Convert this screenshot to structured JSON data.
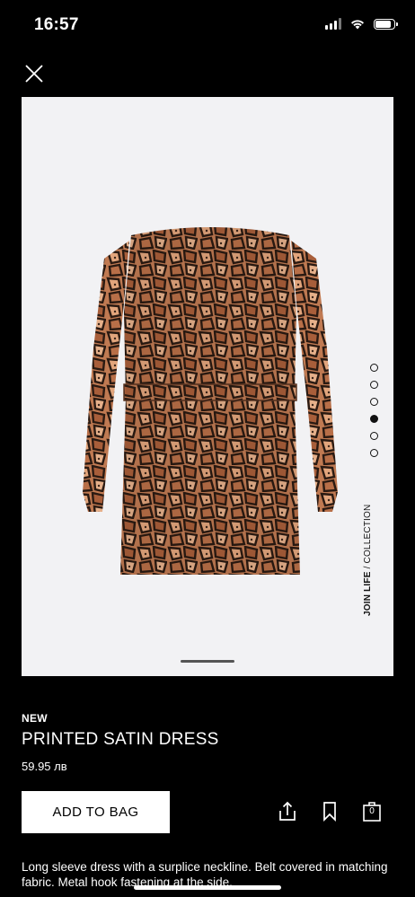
{
  "status_bar": {
    "time": "16:57",
    "icons": [
      "cellular-signal-icon",
      "wifi-icon",
      "battery-icon"
    ],
    "battery_level": 0.85
  },
  "close_icon": "close-icon",
  "gallery": {
    "image": "snake-print-dress-back-photo",
    "dots_count": 6,
    "active_dot": 4,
    "collection_label_bold": "JOIN LIFE",
    "collection_label_rest": " / COLLECTION"
  },
  "product": {
    "badge": "NEW",
    "title": "PRINTED SATIN DRESS",
    "price": "59.95 лв"
  },
  "actions": {
    "add_to_bag": "ADD TO BAG",
    "icons": [
      "share-icon",
      "bookmark-icon",
      "shopping-bag-icon"
    ],
    "bag_count": "0"
  },
  "description": "Long sleeve dress with a surplice neckline. Belt covered in matching fabric. Metal hook fastening at the side.",
  "colors": {
    "background": "#000000",
    "image_panel": "#f2f2f4",
    "dress_base": "#c07a52",
    "dress_dark": "#2a1a12"
  }
}
